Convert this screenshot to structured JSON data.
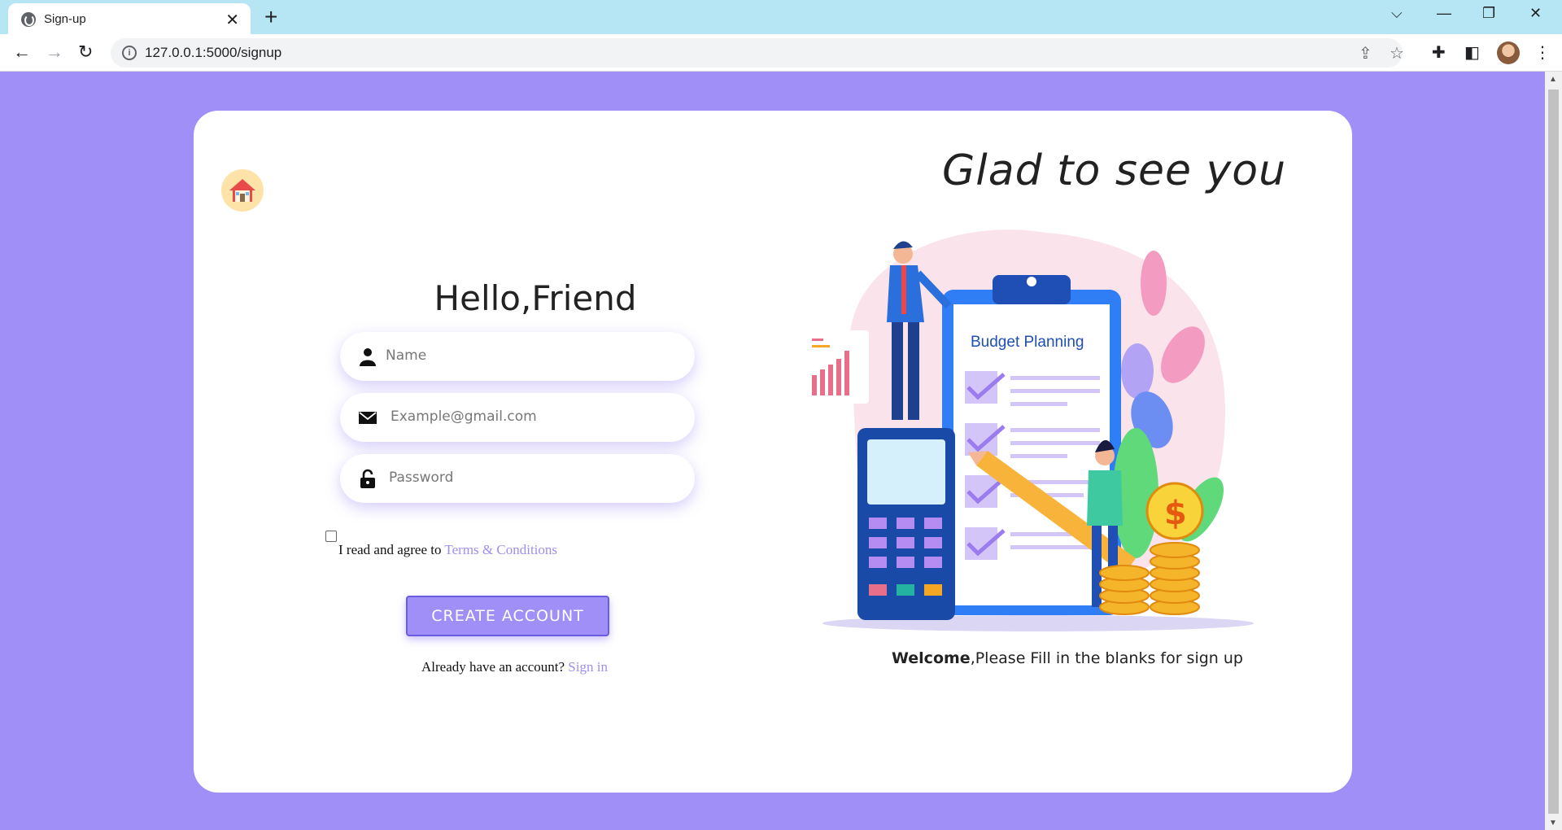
{
  "browser": {
    "tab_title": "Sign-up",
    "tab_close": "✕",
    "new_tab": "+",
    "url": "127.0.0.1:5000/signup",
    "window_controls": {
      "dropdown": "⌵",
      "minimize": "—",
      "restore": "❐",
      "close": "✕"
    }
  },
  "page": {
    "logo_icon": "home-icon",
    "heading": "Hello,Friend",
    "fields": {
      "name_placeholder": "Name",
      "email_placeholder": "Example@gmail.com",
      "password_placeholder": "Password"
    },
    "agree_text": "I read and agree to ",
    "terms_link": "Terms & Conditions",
    "create_button": "CREATE ACCOUNT",
    "already_text": "Already have an account? ",
    "signin_link": "Sign in",
    "right_heading": "Glad to see you",
    "illustration_label": "Budget Planning",
    "welcome_bold": "Welcome",
    "welcome_rest": ",Please Fill in the blanks for sign up"
  },
  "colors": {
    "background": "#a08ff7",
    "accent": "#a08ff7",
    "link": "#9d8ff0",
    "tabbar": "#b6e6f3"
  }
}
